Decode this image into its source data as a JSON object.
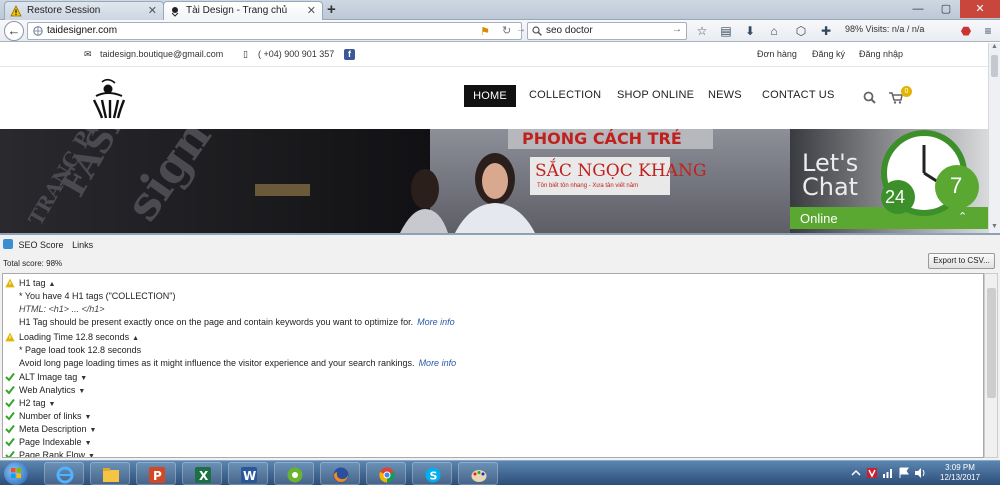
{
  "browser": {
    "tabs": [
      {
        "title": "Restore Session"
      },
      {
        "title": "Tài Design - Trang chủ"
      }
    ],
    "url": "taidesigner.com",
    "search_value": "seo doctor",
    "seo_stats": "98%  Visits: n/a / n/a"
  },
  "site": {
    "topbar": {
      "email": "taidesign.boutique@gmail.com",
      "phone": "( +04) 900 901 357",
      "links": [
        "Đơn hàng",
        "Đăng ký",
        "Đăng nhập"
      ]
    },
    "nav": [
      "HOME",
      "COLLECTION",
      "SHOP ONLINE",
      "NEWS",
      "CONTACT US"
    ],
    "cart_count": "0",
    "banner": {
      "sign1": "PHONG CÁCH TRẺ",
      "sign2": "SẮC NGỌC KHANG",
      "sign2_sub": "Tôn biết tôn nhang - Xưa tân viết năm",
      "chat_text": [
        "Let's",
        "Chat"
      ],
      "clock_numbers": [
        "24",
        "7"
      ],
      "online_label": "Online"
    }
  },
  "seo": {
    "tabs": [
      "SEO Score",
      "Links"
    ],
    "total_score": "Total score: 98%",
    "export_label": "Export to CSV...",
    "h1": {
      "label": "H1 tag",
      "line1": "* You have 4 H1 tags (\"COLLECTION\")",
      "line2": "HTML: <h1> ... </h1>",
      "line3": "H1 Tag should be present exactly once on the page and contain keywords you want to optimize for.",
      "more": "More info"
    },
    "loading": {
      "label": "Loading Time 12.8 seconds",
      "line1": "* Page load took 12.8 seconds",
      "line2": "Avoid long page loading times as it might influence the visitor experience and your search rankings.",
      "more": "More info"
    },
    "checks": [
      "ALT Image tag",
      "Web Analytics",
      "H2 tag",
      "Number of links",
      "Meta Description",
      "Page Indexable",
      "Page Rank Flow"
    ]
  },
  "taskbar": {
    "time": "3:09 PM",
    "date": "12/13/2017"
  },
  "colors": {
    "check_green": "#35a52a",
    "warn_yellow": "#e0b400",
    "online_green": "#5aa832",
    "link_blue": "#2a59a8"
  }
}
